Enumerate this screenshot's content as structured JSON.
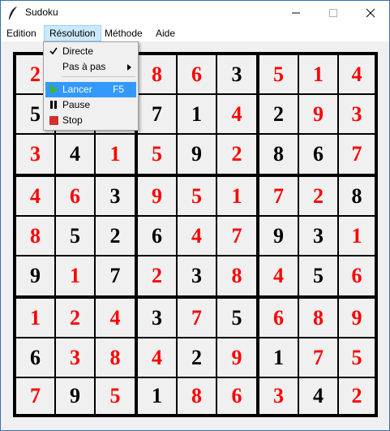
{
  "window": {
    "title": "Sudoku"
  },
  "menubar": [
    "Edition",
    "Résolution",
    "Méthode",
    "Aide"
  ],
  "resolution_menu": {
    "directe": "Directe",
    "pas_a_pas": "Pas à pas",
    "lancer": "Lancer",
    "lancer_shortcut": "F5",
    "pause": "Pause",
    "stop": "Stop"
  },
  "colors": {
    "given": "#000000",
    "solved": "#ff0000",
    "menu_highlight": "#3399ff"
  },
  "grid": [
    [
      [
        "2",
        "r"
      ],
      [
        "",
        ""
      ],
      [
        "",
        ""
      ],
      [
        "8",
        "r"
      ],
      [
        "6",
        "r"
      ],
      [
        "3",
        "k"
      ],
      [
        "5",
        "r"
      ],
      [
        "1",
        "r"
      ],
      [
        "4",
        "r"
      ]
    ],
    [
      [
        "5",
        "k"
      ],
      [
        "",
        ""
      ],
      [
        "",
        ""
      ],
      [
        "7",
        "k"
      ],
      [
        "1",
        "k"
      ],
      [
        "4",
        "r"
      ],
      [
        "2",
        "k"
      ],
      [
        "9",
        "r"
      ],
      [
        "3",
        "r"
      ]
    ],
    [
      [
        "3",
        "r"
      ],
      [
        "4",
        "k"
      ],
      [
        "1",
        "r"
      ],
      [
        "5",
        "r"
      ],
      [
        "9",
        "k"
      ],
      [
        "2",
        "r"
      ],
      [
        "8",
        "k"
      ],
      [
        "6",
        "k"
      ],
      [
        "7",
        "r"
      ]
    ],
    [
      [
        "4",
        "r"
      ],
      [
        "6",
        "r"
      ],
      [
        "3",
        "k"
      ],
      [
        "9",
        "r"
      ],
      [
        "5",
        "r"
      ],
      [
        "1",
        "r"
      ],
      [
        "7",
        "r"
      ],
      [
        "2",
        "r"
      ],
      [
        "8",
        "k"
      ]
    ],
    [
      [
        "8",
        "r"
      ],
      [
        "5",
        "k"
      ],
      [
        "2",
        "k"
      ],
      [
        "6",
        "k"
      ],
      [
        "4",
        "r"
      ],
      [
        "7",
        "r"
      ],
      [
        "9",
        "k"
      ],
      [
        "3",
        "k"
      ],
      [
        "1",
        "r"
      ]
    ],
    [
      [
        "9",
        "k"
      ],
      [
        "1",
        "r"
      ],
      [
        "7",
        "k"
      ],
      [
        "2",
        "r"
      ],
      [
        "3",
        "k"
      ],
      [
        "8",
        "r"
      ],
      [
        "4",
        "r"
      ],
      [
        "5",
        "k"
      ],
      [
        "6",
        "r"
      ]
    ],
    [
      [
        "1",
        "r"
      ],
      [
        "2",
        "r"
      ],
      [
        "4",
        "r"
      ],
      [
        "3",
        "k"
      ],
      [
        "7",
        "r"
      ],
      [
        "5",
        "k"
      ],
      [
        "6",
        "r"
      ],
      [
        "8",
        "r"
      ],
      [
        "9",
        "r"
      ]
    ],
    [
      [
        "6",
        "k"
      ],
      [
        "3",
        "r"
      ],
      [
        "8",
        "r"
      ],
      [
        "4",
        "r"
      ],
      [
        "2",
        "k"
      ],
      [
        "9",
        "r"
      ],
      [
        "1",
        "k"
      ],
      [
        "7",
        "r"
      ],
      [
        "5",
        "r"
      ]
    ],
    [
      [
        "7",
        "r"
      ],
      [
        "9",
        "k"
      ],
      [
        "5",
        "r"
      ],
      [
        "1",
        "k"
      ],
      [
        "8",
        "r"
      ],
      [
        "6",
        "r"
      ],
      [
        "3",
        "r"
      ],
      [
        "4",
        "k"
      ],
      [
        "2",
        "r"
      ]
    ]
  ]
}
